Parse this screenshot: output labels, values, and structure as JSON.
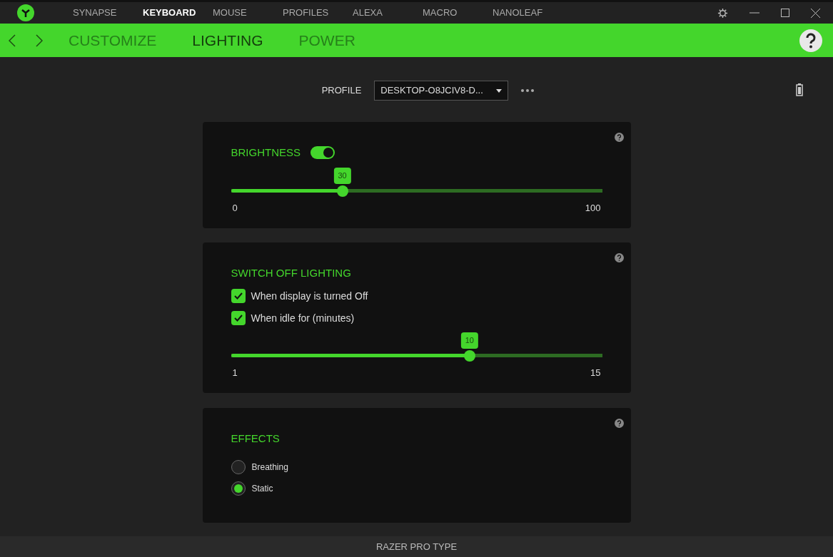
{
  "top_nav": [
    {
      "label": "SYNAPSE",
      "selected": false
    },
    {
      "label": "KEYBOARD",
      "selected": true
    },
    {
      "label": "MOUSE",
      "selected": false
    },
    {
      "label": "PROFILES",
      "selected": false
    },
    {
      "label": "ALEXA",
      "selected": false
    },
    {
      "label": "MACRO",
      "selected": false
    },
    {
      "label": "NANOLEAF",
      "selected": false
    }
  ],
  "sub_tabs": [
    {
      "label": "CUSTOMIZE",
      "selected": false
    },
    {
      "label": "LIGHTING",
      "selected": true
    },
    {
      "label": "POWER",
      "selected": false
    }
  ],
  "profile": {
    "label": "PROFILE",
    "value": "DESKTOP-O8JCIV8-D..."
  },
  "brightness": {
    "title": "BRIGHTNESS",
    "on": true,
    "slider": {
      "value": "30",
      "level": 0.3,
      "min": "0",
      "max": "100"
    }
  },
  "switch_off": {
    "title": "SWITCH OFF LIGHTING",
    "options": [
      {
        "label": "When display is turned Off",
        "checked": true
      },
      {
        "label": "When idle for (minutes)",
        "checked": true
      }
    ],
    "slider": {
      "value": "10",
      "level": 0.643,
      "min": "1",
      "max": "15"
    }
  },
  "effects": {
    "title": "EFFECTS",
    "options": [
      {
        "label": "Breathing",
        "selected": false
      },
      {
        "label": "Static",
        "selected": true
      }
    ]
  },
  "status_bar": "RAZER PRO TYPE"
}
